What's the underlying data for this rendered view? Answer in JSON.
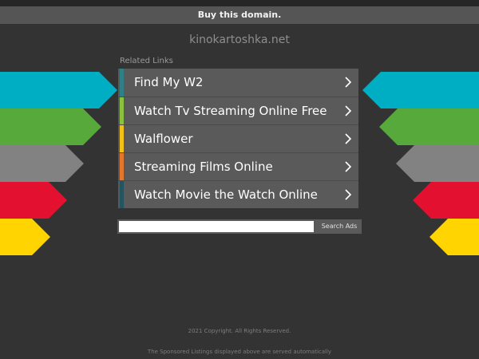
{
  "banner": {
    "buy_label": "Buy this domain."
  },
  "header": {
    "domain": "kinokartoshka.net"
  },
  "related": {
    "title": "Related Links"
  },
  "colors": {
    "background": "#333333",
    "cyan": "#00aec3",
    "green": "#56a93a",
    "gray": "#828282",
    "red": "#e3112f",
    "yellow": "#ffd400",
    "link_box": "#5a5a5a"
  },
  "links": [
    {
      "label": "Find My W2",
      "strip_color": "#2f7f87",
      "icon": "chevron-right-icon"
    },
    {
      "label": "Watch Tv Streaming Online Free",
      "strip_color": "#8ac240",
      "icon": "chevron-right-icon"
    },
    {
      "label": "Walflower",
      "strip_color": "#f3c018",
      "icon": "chevron-right-icon"
    },
    {
      "label": "Streaming Films Online",
      "strip_color": "#e5762b",
      "icon": "chevron-right-icon"
    },
    {
      "label": "Watch Movie the Watch Online",
      "strip_color": "#23545f",
      "icon": "chevron-right-icon"
    }
  ],
  "search": {
    "button_label": "Search Ads",
    "placeholder": ""
  },
  "footer": {
    "copyright": "2021 Copyright. All Rights Reserved.",
    "sponsored": "The Sponsored Listings displayed above are served automatically"
  }
}
